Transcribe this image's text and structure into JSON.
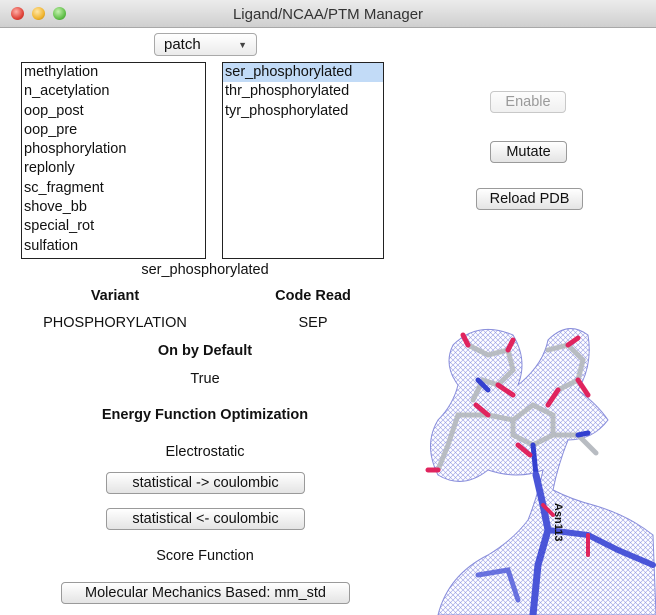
{
  "window": {
    "title": "Ligand/NCAA/PTM Manager"
  },
  "type_select": {
    "value": "patch"
  },
  "patch_list": {
    "items": [
      "methylation",
      "n_acetylation",
      "oop_post",
      "oop_pre",
      "phosphorylation",
      "replonly",
      "sc_fragment",
      "shove_bb",
      "special_rot",
      "sulfation"
    ]
  },
  "variant_list": {
    "items": [
      "ser_phosphorylated",
      "thr_phosphorylated",
      "tyr_phosphorylated"
    ],
    "selected": "ser_phosphorylated"
  },
  "actions": {
    "enable": "Enable",
    "mutate": "Mutate",
    "reload_pdb": "Reload PDB"
  },
  "details": {
    "selected_name": "ser_phosphorylated",
    "variant_header": "Variant",
    "variant_value": "PHOSPHORYLATION",
    "code_read_header": "Code Read",
    "code_read_value": "SEP",
    "on_by_default_header": "On by Default",
    "on_by_default_value": "True",
    "energy_header": "Energy Function Optimization",
    "electrostatic_label": "Electrostatic",
    "stat_to_coul": "statistical -> coulombic",
    "coul_to_stat": "statistical <- coulombic",
    "score_function_label": "Score Function",
    "score_function_button": "Molecular Mechanics Based: mm_std"
  },
  "structure_image": {
    "residue_label": "Asn113",
    "colors": {
      "mesh": "#8a8fe0",
      "carbon": "#b8bcc2",
      "oxygen": "#e0245e",
      "nitrogen": "#3340d0",
      "backbone": "#4a55d8"
    }
  }
}
